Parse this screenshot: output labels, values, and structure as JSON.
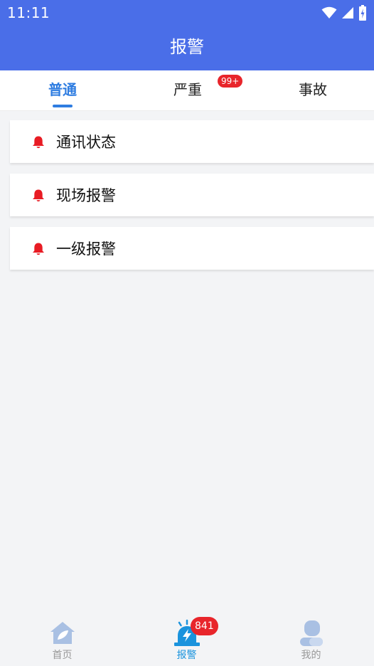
{
  "status_bar": {
    "time": "11:11",
    "icons": [
      "wifi-icon",
      "signal-icon",
      "battery-icon"
    ]
  },
  "header": {
    "title": "报警"
  },
  "tabs": [
    {
      "label": "普通",
      "active": true
    },
    {
      "label": "严重",
      "badge": "99+"
    },
    {
      "label": "事故"
    }
  ],
  "alarms": [
    {
      "label": "通讯状态",
      "icon": "bell-icon"
    },
    {
      "label": "现场报警",
      "icon": "bell-icon"
    },
    {
      "label": "一级报警",
      "icon": "bell-icon"
    }
  ],
  "bottom_nav": [
    {
      "label": "首页",
      "icon": "home-icon"
    },
    {
      "label": "报警",
      "icon": "alarm-siren-icon",
      "active": true,
      "badge": "841"
    },
    {
      "label": "我的",
      "icon": "profile-icon"
    }
  ],
  "colors": {
    "primary": "#4a6ee8",
    "tab_active": "#2f7de1",
    "badge": "#e8252b",
    "bell": "#e81c24",
    "nav_active": "#1a93dd",
    "nav_inactive": "#9fb8dc"
  }
}
